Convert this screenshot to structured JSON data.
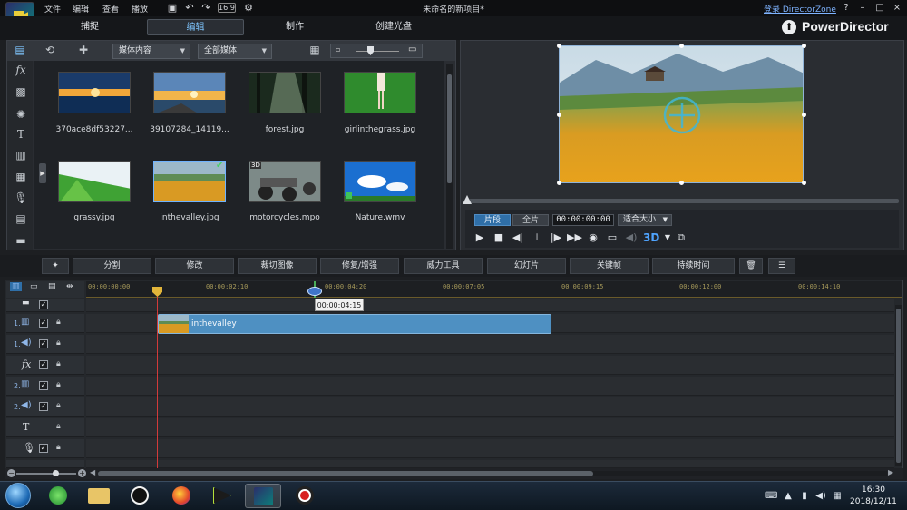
{
  "menubar": {
    "items": [
      "文件",
      "编辑",
      "查看",
      "播放"
    ],
    "project_title": "未命名的新项目*",
    "login_link": "登录 DirectorZone",
    "window_controls": [
      "?",
      "–",
      "□",
      "×"
    ]
  },
  "mode_tabs": [
    {
      "label": "捕捉"
    },
    {
      "label": "编辑"
    },
    {
      "label": "制作"
    },
    {
      "label": "创建光盘"
    }
  ],
  "brand": "PowerDirector",
  "library": {
    "filter1": "媒体内容",
    "filter2": "全部媒体",
    "items": [
      {
        "label": "370ace8df53227..."
      },
      {
        "label": "39107284_14119..."
      },
      {
        "label": "forest.jpg"
      },
      {
        "label": "girlinthegrass.jpg"
      },
      {
        "label": "grassy.jpg"
      },
      {
        "label": "inthevalley.jpg"
      },
      {
        "label": "motorcycles.mpo"
      },
      {
        "label": "Nature.wmv"
      }
    ]
  },
  "player": {
    "clip_label": "片段",
    "full_label": "全片",
    "timecode": "00:00:00:00",
    "fit_label": "适合大小",
    "three_d": "3D"
  },
  "functions": [
    "分割",
    "修改",
    "裁切图像",
    "修复/增强",
    "威力工具",
    "幻灯片",
    "关键帧",
    "持续时间"
  ],
  "timeline": {
    "ruler_ticks": [
      "00:00:00:00",
      "00:00:02:10",
      "00:00:04:20",
      "00:00:07:05",
      "00:00:09:15",
      "00:00:12:00",
      "00:00:14:10"
    ],
    "cursor_tooltip": "00:00:04:15",
    "clip_label": "inthevalley",
    "track_numbers": [
      "1.",
      "1.",
      "2.",
      "2."
    ]
  },
  "taskbar": {
    "time": "16:30",
    "date": "2018/12/11"
  }
}
